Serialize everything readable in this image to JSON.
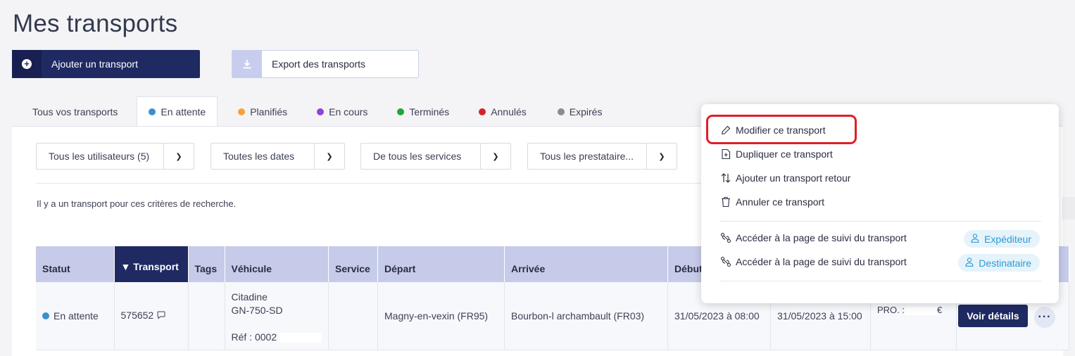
{
  "page": {
    "title": "Mes transports"
  },
  "actions": {
    "add_label": "Ajouter un transport",
    "export_label": "Export des transports"
  },
  "tabs": [
    {
      "label": "Tous vos transports",
      "color": ""
    },
    {
      "label": "En attente",
      "color": "#3b8fd0",
      "active": true
    },
    {
      "label": "Planifiés",
      "color": "#f5a23a"
    },
    {
      "label": "En cours",
      "color": "#8e44d6"
    },
    {
      "label": "Terminés",
      "color": "#1fa637"
    },
    {
      "label": "Annulés",
      "color": "#d6212a"
    },
    {
      "label": "Expirés",
      "color": "#8c8c8c"
    }
  ],
  "filters": {
    "users": "Tous les utilisateurs (5)",
    "dates": "Toutes les dates",
    "services": "De tous les services",
    "providers": "Tous les prestataire..."
  },
  "results": {
    "text": "Il y a un transport pour ces critères de recherche."
  },
  "table": {
    "columns": [
      "Statut",
      "▼ Transport",
      "Tags",
      "Véhicule",
      "Service",
      "Départ",
      "Arrivée",
      "Début",
      "",
      "",
      ""
    ],
    "row": {
      "status": "En attente",
      "status_color": "#3b8fd0",
      "transport": "575652",
      "vehicle_type": "Citadine",
      "vehicle_plate": "GN-750-SD",
      "vehicle_ref": "Réf : 0002",
      "departure": "Magny-en-vexin (FR95)",
      "arrival": "Bourbon-l archambault (FR03)",
      "start": "31/05/2023 à 08:00",
      "end": "31/05/2023 à 15:00",
      "price_label": "PRO. :",
      "price_currency": "€",
      "details_label": "Voir détails"
    }
  },
  "menu": {
    "edit": "Modifier ce transport",
    "duplicate": "Dupliquer ce transport",
    "return": "Ajouter un transport retour",
    "cancel": "Annuler ce transport",
    "tracking_1": "Accéder à la page de suivi du transport",
    "tracking_2": "Accéder à la page de suivi du transport",
    "sender": "Expéditeur",
    "recipient": "Destinataire"
  },
  "colors": {
    "primary": "#1f2a63",
    "header": "#c6cbea",
    "highlight": "#e01e26",
    "accent": "#2a9bd7"
  },
  "icons": [
    "plus-circle-icon",
    "download-icon",
    "chevron-down-icon",
    "comment-icon",
    "pencil-icon",
    "duplicate-icon",
    "swap-arrows-icon",
    "trash-icon",
    "route-icon",
    "user-icon",
    "more-icon"
  ]
}
